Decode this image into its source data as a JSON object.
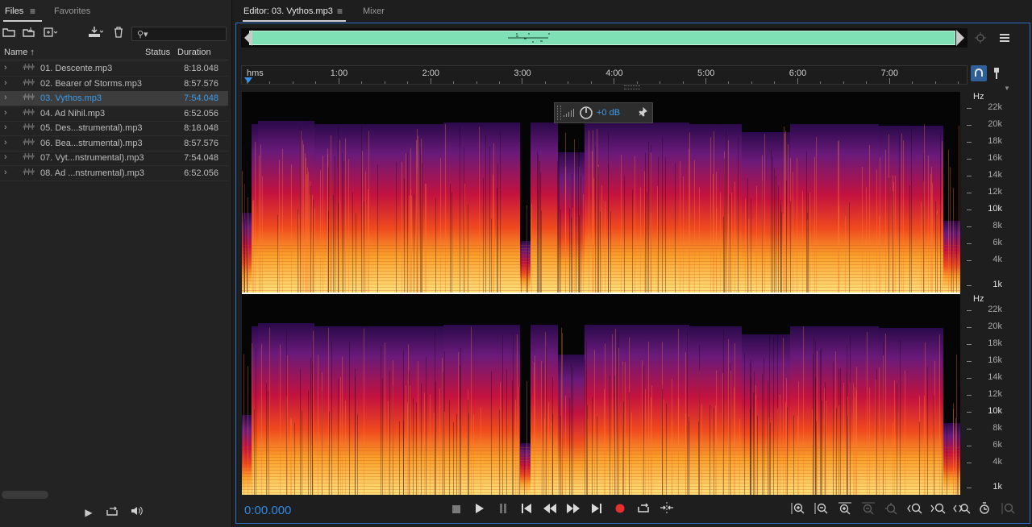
{
  "files_panel": {
    "tabs": [
      {
        "label": "Files",
        "menu": "≡"
      },
      {
        "label": "Favorites"
      }
    ],
    "search_placeholder": "",
    "columns": {
      "name": "Name ↑",
      "status": "Status",
      "duration": "Duration"
    },
    "files": [
      {
        "name": "01. Descente.mp3",
        "duration": "8:18.048",
        "selected": false
      },
      {
        "name": "02. Bearer of Storms.mp3",
        "duration": "8:57.576",
        "selected": false
      },
      {
        "name": "03. Vythos.mp3",
        "duration": "7:54.048",
        "selected": true
      },
      {
        "name": "04. Ad Nihil.mp3",
        "duration": "6:52.056",
        "selected": false
      },
      {
        "name": "05. Des...strumental).mp3",
        "duration": "8:18.048",
        "selected": false
      },
      {
        "name": "06. Bea...strumental).mp3",
        "duration": "8:57.576",
        "selected": false
      },
      {
        "name": "07. Vyt...nstrumental).mp3",
        "duration": "7:54.048",
        "selected": false
      },
      {
        "name": "08. Ad ...nstrumental).mp3",
        "duration": "6:52.056",
        "selected": false
      }
    ]
  },
  "editor": {
    "tab_label": "Editor: 03. Vythos.mp3",
    "tab_menu": "≡",
    "mixer_label": "Mixer",
    "ruler_labels": [
      "hms",
      "1:00",
      "2:00",
      "3:00",
      "4:00",
      "5:00",
      "6:00",
      "7:00"
    ],
    "hz_unit": "Hz",
    "hz_labels": [
      "22k",
      "20k",
      "18k",
      "16k",
      "14k",
      "12k",
      "10k",
      "8k",
      "6k",
      "4k",
      "1k"
    ],
    "gain_label": "+0 dB",
    "time": "0:00.000"
  },
  "colors": {
    "accent": "#2f8ae0",
    "overview_wave": "#7ee0b4",
    "selection_text": "#3d9ae8",
    "record": "#e53030"
  },
  "icons": {
    "file_toolbar": [
      "open-folder-icon",
      "import-icon",
      "new-file-icon",
      "insert-into-multitrack-icon",
      "delete-icon",
      "search-icon"
    ],
    "transport": [
      "stop-icon",
      "play-icon",
      "pause-icon",
      "go-to-start-icon",
      "rewind-icon",
      "fast-forward-icon",
      "go-to-end-icon",
      "record-icon",
      "loop-icon",
      "skip-selection-icon"
    ],
    "zoom": [
      "zoom-in-amplitude-icon",
      "zoom-out-amplitude-icon",
      "zoom-in-time-icon",
      "zoom-out-time-icon",
      "zoom-full-icon",
      "zoom-in-left-icon",
      "zoom-in-right-icon",
      "zoom-out-full-icon",
      "zoom-selection-icon",
      "zoom-reset-icon"
    ]
  }
}
